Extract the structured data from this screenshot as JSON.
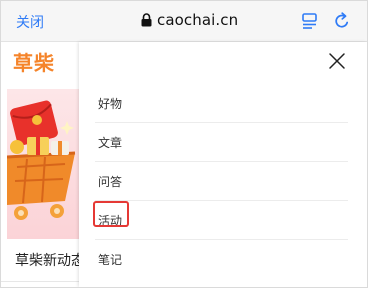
{
  "browser": {
    "close_label": "关闭",
    "url": "caochai.cn",
    "icons": {
      "lock": "lock-icon",
      "reader": "reader-mode-icon",
      "reload": "reload-icon"
    },
    "accent_color": "#2f7bf6"
  },
  "site": {
    "logo_text": "草柴",
    "brand_color": "#f5842a"
  },
  "promo": {
    "title": "草柴新动态"
  },
  "menu": {
    "close_icon": "close-icon",
    "items": [
      {
        "label": "好物"
      },
      {
        "label": "文章"
      },
      {
        "label": "问答"
      },
      {
        "label": "活动",
        "highlighted": true
      },
      {
        "label": "笔记"
      }
    ],
    "highlight_color": "#e53935"
  }
}
